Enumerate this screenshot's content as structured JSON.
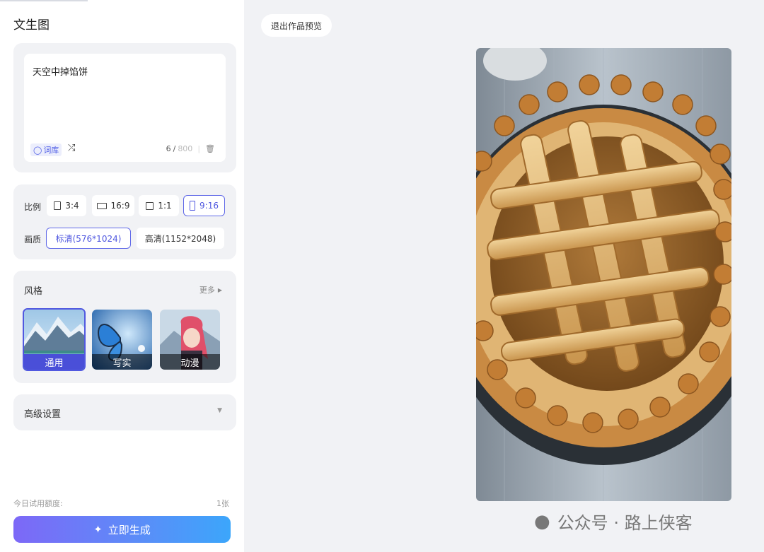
{
  "panel": {
    "title": "文生图",
    "prompt": {
      "text": "天空中掉馅饼",
      "lexicon_label": "词库",
      "count_current": "6",
      "count_sep": "/",
      "count_max": "800"
    },
    "ratio": {
      "label": "比例",
      "options": [
        "3:4",
        "16:9",
        "1:1",
        "9:16"
      ],
      "selected": "9:16"
    },
    "quality": {
      "label": "画质",
      "options": [
        "标清(576*1024)",
        "高清(1152*2048)"
      ],
      "selected": "标清(576*1024)"
    },
    "style": {
      "title": "风格",
      "more": "更多",
      "items": [
        "通用",
        "写实",
        "动漫"
      ],
      "selected": "通用"
    },
    "advanced": {
      "label": "高级设置"
    },
    "quota": {
      "label": "今日试用额度:",
      "value": "1张"
    },
    "generate": {
      "label": "立即生成"
    }
  },
  "preview": {
    "exit_label": "退出作品预览",
    "watermark": "公众号 · 路上侠客"
  },
  "colors": {
    "accent": "#5058e0",
    "panel_bg": "#f1f2f5"
  }
}
